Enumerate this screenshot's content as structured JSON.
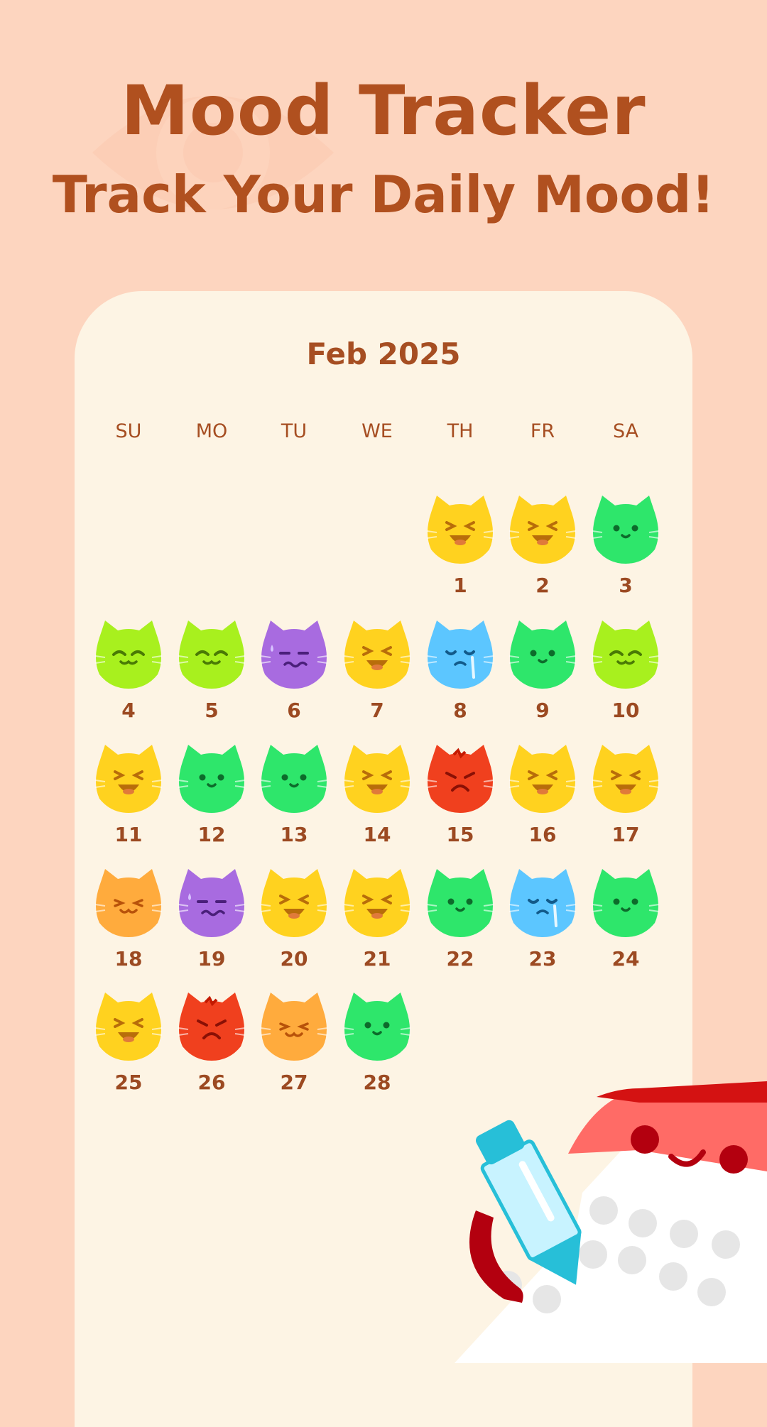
{
  "header": {
    "title": "Mood Tracker",
    "subtitle": "Track Your Daily Mood!"
  },
  "calendar": {
    "month_label": "Feb 2025",
    "weekdays": [
      "SU",
      "MO",
      "TU",
      "WE",
      "TH",
      "FR",
      "SA"
    ],
    "days": [
      {
        "day": "1",
        "mood": "laughing",
        "color": "#ffd21f"
      },
      {
        "day": "2",
        "mood": "laughing",
        "color": "#ffd21f"
      },
      {
        "day": "3",
        "mood": "calm",
        "color": "#2ee66b"
      },
      {
        "day": "4",
        "mood": "content",
        "color": "#a8f01e"
      },
      {
        "day": "5",
        "mood": "content",
        "color": "#a8f01e"
      },
      {
        "day": "6",
        "mood": "anxious",
        "color": "#a86be0"
      },
      {
        "day": "7",
        "mood": "laughing",
        "color": "#ffd21f"
      },
      {
        "day": "8",
        "mood": "sad",
        "color": "#5cc6ff"
      },
      {
        "day": "9",
        "mood": "calm",
        "color": "#2ee66b"
      },
      {
        "day": "10",
        "mood": "content",
        "color": "#a8f01e"
      },
      {
        "day": "11",
        "mood": "laughing",
        "color": "#ffd21f"
      },
      {
        "day": "12",
        "mood": "calm",
        "color": "#2ee66b"
      },
      {
        "day": "13",
        "mood": "calm",
        "color": "#2ee66b"
      },
      {
        "day": "14",
        "mood": "laughing",
        "color": "#ffd21f"
      },
      {
        "day": "15",
        "mood": "angry",
        "color": "#f0401e"
      },
      {
        "day": "16",
        "mood": "laughing",
        "color": "#ffd21f"
      },
      {
        "day": "17",
        "mood": "laughing",
        "color": "#ffd21f"
      },
      {
        "day": "18",
        "mood": "smiling",
        "color": "#ffab3d"
      },
      {
        "day": "19",
        "mood": "anxious",
        "color": "#a86be0"
      },
      {
        "day": "20",
        "mood": "laughing",
        "color": "#ffd21f"
      },
      {
        "day": "21",
        "mood": "laughing",
        "color": "#ffd21f"
      },
      {
        "day": "22",
        "mood": "calm",
        "color": "#2ee66b"
      },
      {
        "day": "23",
        "mood": "sad",
        "color": "#5cc6ff"
      },
      {
        "day": "24",
        "mood": "calm",
        "color": "#2ee66b"
      },
      {
        "day": "25",
        "mood": "laughing",
        "color": "#ffd21f"
      },
      {
        "day": "26",
        "mood": "angry",
        "color": "#f0401e"
      },
      {
        "day": "27",
        "mood": "smiling",
        "color": "#ffab3d"
      },
      {
        "day": "28",
        "mood": "calm",
        "color": "#2ee66b"
      }
    ]
  },
  "colors": {
    "background": "#fdd5bf",
    "card": "#fdf4e4",
    "accent_text": "#b0501f"
  },
  "icons": {
    "background": "eye-watermark-icon",
    "decoration": "calendar-with-pen-icon"
  }
}
